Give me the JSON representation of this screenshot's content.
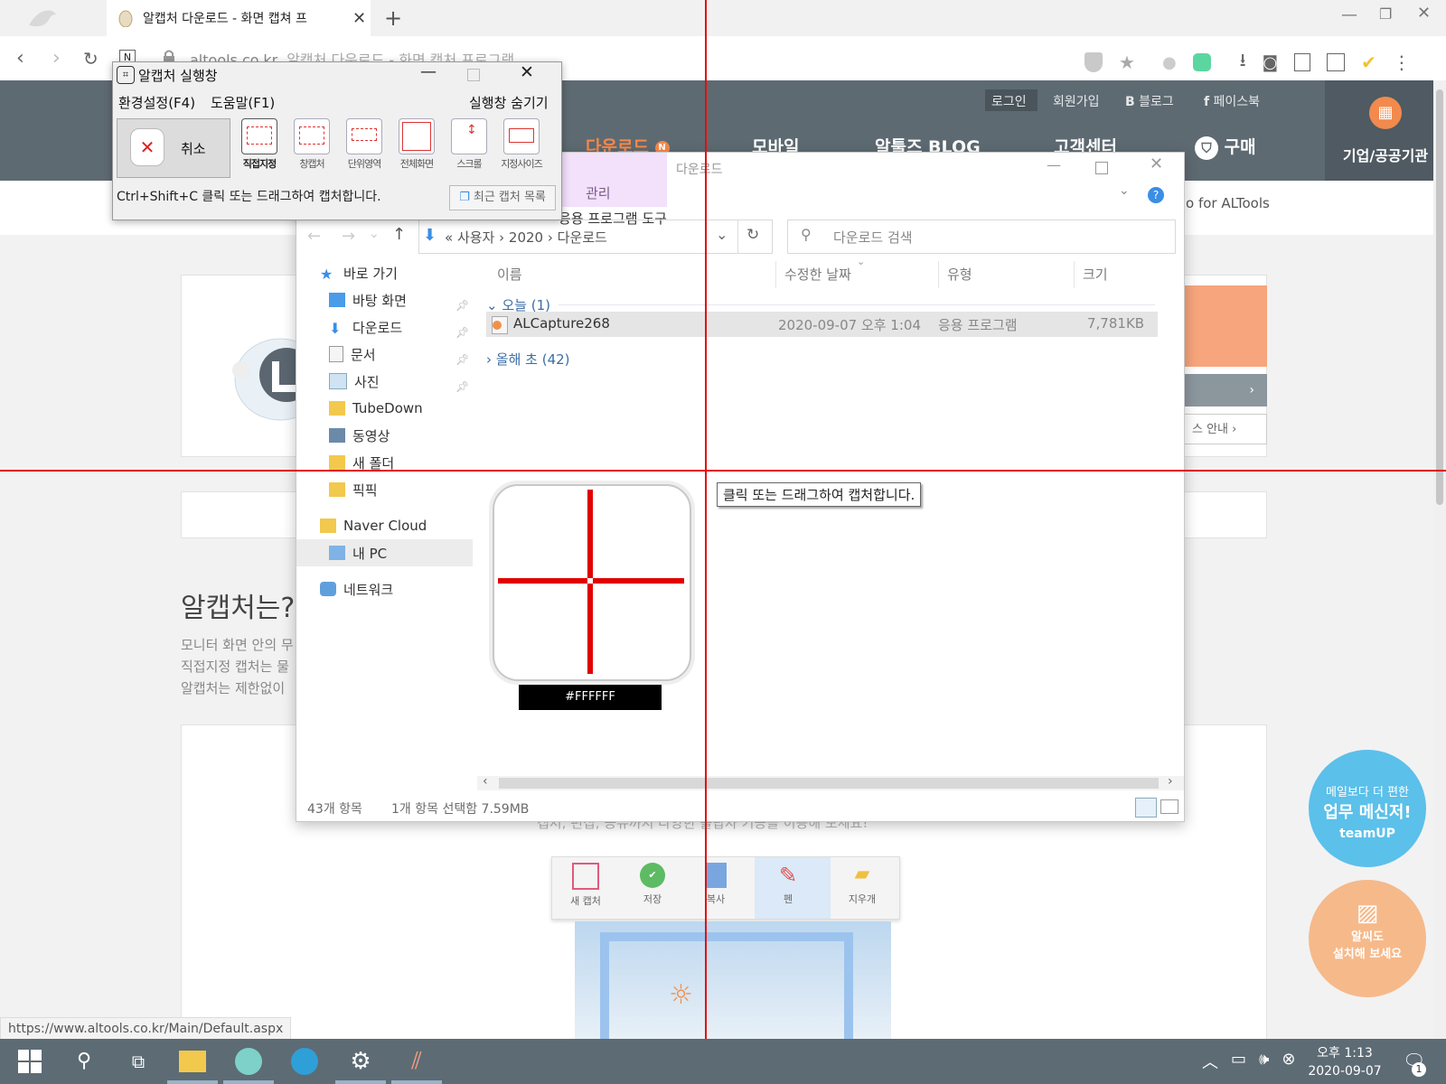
{
  "browser": {
    "tab_title": "알캡처 다운로드 - 화면 캡쳐 프",
    "url": "altools.co.kr",
    "page_heading_in_url": "알캡처 다운로드 - 화면 캡처 프로그램",
    "status_url": "https://www.altools.co.kr/Main/Default.aspx"
  },
  "site": {
    "util_links": [
      "로그인",
      "회원가입",
      "블로그",
      "페이스북"
    ],
    "nav": [
      "다운로드",
      "모바일",
      "알툴즈 BLOG",
      "고객센터",
      "구매"
    ],
    "new_badge": "N",
    "corp": "기업/공공기관",
    "pro_text": "o for ALTools",
    "side_link": "스 안내",
    "section_title": "알캡처는?",
    "desc_lines": [
      "모니터 화면 안의 무",
      "직접지정 캡처는 물",
      "알캡처는 제한없이"
    ],
    "desc_bottom": "캡처, 편집, 공유까지 다양한 플랍자 기능을 이용해 보세요!",
    "editor_tools": [
      "새 캡처",
      "저장",
      "복사",
      "펜",
      "지우개"
    ],
    "promo1": [
      "메일보다 더 편한",
      "업무 메신저!",
      "teamUP"
    ],
    "promo2": [
      "알씨도",
      "설치해 보세요"
    ]
  },
  "explorer": {
    "title": "다운로드",
    "ribbon_tab_manage": "관리",
    "ribbon_app_tools": "응용 프로그램 도구",
    "breadcrumb": [
      "사용자",
      "2020",
      "다운로드"
    ],
    "search_placeholder": "다운로드 검색",
    "columns": [
      "이름",
      "수정한 날짜",
      "유형",
      "크기"
    ],
    "group_today": "오늘 (1)",
    "group_year": "올해 초 (42)",
    "file": {
      "name": "ALCapture268",
      "date": "2020-09-07 오후 1:04",
      "type": "응용 프로그램",
      "size": "7,781KB"
    },
    "nav_items": [
      "바로 가기",
      "바탕 화면",
      "다운로드",
      "문서",
      "사진",
      "TubeDown",
      "동영상",
      "새 폴더",
      "픽픽",
      "Naver Cloud",
      "내 PC",
      "네트워크"
    ],
    "status_count": "43개 항목",
    "status_selected": "1개 항목 선택함 7.59MB"
  },
  "capture_tool": {
    "title": "알캡처 실행창",
    "menu_settings": "환경설정(F4)",
    "menu_help": "도움말(F1)",
    "menu_hide": "실행창 숨기기",
    "cancel": "취소",
    "tools": [
      "직접지정",
      "창캡처",
      "단위영역",
      "전체화면",
      "스크롤",
      "지정사이즈"
    ],
    "hint": "Ctrl+Shift+C 클릭 또는 드래그하여 캡처합니다.",
    "recent": "최근 캡처 목록"
  },
  "overlay": {
    "color_hex": "#FFFFFF",
    "tooltip": "클릭 또는 드래그하여 캡처합니다."
  },
  "taskbar": {
    "time": "오후 1:13",
    "date": "2020-09-07",
    "notification_count": "1"
  },
  "colors": {
    "crosshair": "#e01010",
    "nav_bg": "#5e6a72",
    "taskbar": "#5d6b74",
    "accent_orange": "#f28a4d"
  }
}
